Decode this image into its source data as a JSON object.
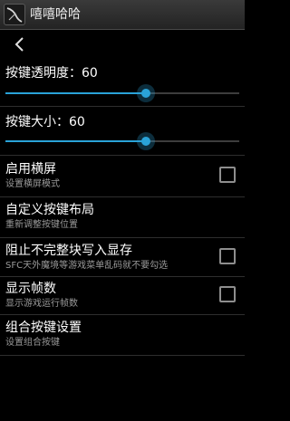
{
  "app": {
    "title": "嘻嘻哈哈",
    "icon": "app-logo-icon"
  },
  "nav": {
    "back_icon": "chevron-left-icon"
  },
  "sliders": [
    {
      "label": "按键透明度：60",
      "value": 60,
      "fraction": 0.6,
      "accent": "#2aa3d8"
    },
    {
      "label": "按键大小：60",
      "value": 60,
      "fraction": 0.6,
      "accent": "#2aa3d8"
    }
  ],
  "prefs": [
    {
      "title": "启用横屏",
      "summary": "设置横屏模式",
      "checkbox": true,
      "checked": false
    },
    {
      "title": "自定义按键布局",
      "summary": "重新调整按键位置",
      "checkbox": false
    },
    {
      "title": "阻止不完整块写入显存",
      "summary": "SFC天外魔境等游戏菜单乱码就不要勾选",
      "checkbox": true,
      "checked": false
    },
    {
      "title": "显示帧数",
      "summary": "显示游戏运行帧数",
      "checkbox": true,
      "checked": false
    },
    {
      "title": "组合按键设置",
      "summary": "设置组合按键",
      "checkbox": false
    }
  ]
}
